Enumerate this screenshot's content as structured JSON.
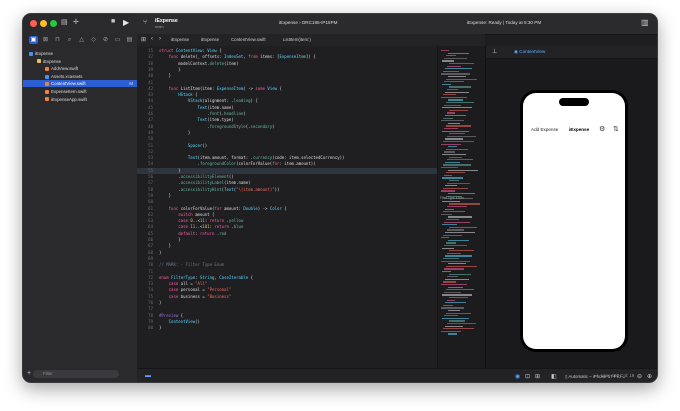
{
  "sidebar": {
    "items": [
      {
        "label": "iExpense",
        "level": 0,
        "color": "#4a90f5",
        "selected": false
      },
      {
        "label": "iExpense",
        "level": 1,
        "color": "#e8c35a",
        "selected": false
      },
      {
        "label": "AddView.swift",
        "level": 2,
        "color": "#f0813a",
        "selected": false
      },
      {
        "label": "Assets.xcassets",
        "level": 2,
        "color": "#4a90f5",
        "selected": false
      },
      {
        "label": "ContentView.swift",
        "level": 2,
        "color": "#f0813a",
        "selected": true,
        "badge": "M"
      },
      {
        "label": "ExpenseItem.swift",
        "level": 2,
        "color": "#f0813a",
        "selected": false
      },
      {
        "label": "iExpenseApp.swift",
        "level": 2,
        "color": "#f0813a",
        "selected": false
      }
    ],
    "filter_placeholder": "Filter"
  },
  "titlebar": {
    "project": "iExpense",
    "branch": "main",
    "scheme": "iExpense  ›  DRC195-IP15PM",
    "status": "iExpense: Ready | Today at 5:30 PM"
  },
  "breadcrumb": [
    "iExpense",
    "iExpense",
    "ContentView.swift",
    "ListItem(item:)"
  ],
  "code": [
    {
      "n": "15",
      "t": "struct ContentView: View {"
    },
    {
      "n": "37",
      "t": "    func delete(_ offsets: IndexSet, from items: [ExpenseItem]) {"
    },
    {
      "n": "38",
      "t": "        modelContext.delete(item)"
    },
    {
      "n": "39",
      "t": "        }"
    },
    {
      "n": "40",
      "t": "    }"
    },
    {
      "n": "41",
      "t": ""
    },
    {
      "n": "42",
      "t": "    func ListItem(item: ExpenseItem) -> some View {"
    },
    {
      "n": "43",
      "t": "        HStack {"
    },
    {
      "n": "44",
      "t": "            VStack(alignment: .leading) {"
    },
    {
      "n": "45",
      "t": "                Text(item.name)"
    },
    {
      "n": "46",
      "t": "                    .font(.headline)"
    },
    {
      "n": "47",
      "t": "                Text(item.type)"
    },
    {
      "n": "48",
      "t": "                    .foregroundStyle(.secondary)"
    },
    {
      "n": "49",
      "t": "            }"
    },
    {
      "n": "50",
      "t": ""
    },
    {
      "n": "51",
      "t": "            Spacer()"
    },
    {
      "n": "52",
      "t": ""
    },
    {
      "n": "53",
      "t": "            Text(item.amount, format: .currency(code: item.selectedCurrency))"
    },
    {
      "n": "54",
      "t": "                .foregroundColor(colorForValue(for: item.amount))"
    },
    {
      "n": "55",
      "t": "        }"
    },
    {
      "n": "56",
      "t": "        .accessibilityElement()"
    },
    {
      "n": "57",
      "t": "        .accessibilityLabel(item.name)"
    },
    {
      "n": "58",
      "t": "        .accessibilityHint(Text(\"\\(item.amount)\"))"
    },
    {
      "n": "59",
      "t": "    }"
    },
    {
      "n": "60",
      "t": ""
    },
    {
      "n": "61",
      "t": "    func colorForValue(for amount: Double) -> Color {"
    },
    {
      "n": "62",
      "t": "        switch amount {"
    },
    {
      "n": "63",
      "t": "        case 0..<11: return .yellow"
    },
    {
      "n": "64",
      "t": "        case 11..<101: return .blue"
    },
    {
      "n": "65",
      "t": "        default: return .red"
    },
    {
      "n": "66",
      "t": "        }"
    },
    {
      "n": "67",
      "t": "    }"
    },
    {
      "n": "68",
      "t": "}"
    },
    {
      "n": "69",
      "t": ""
    },
    {
      "n": "70",
      "t": "// MARK: - Filter Type Enum"
    },
    {
      "n": "71",
      "t": ""
    },
    {
      "n": "72",
      "t": "enum FilterType: String, CaseIterable {"
    },
    {
      "n": "73",
      "t": "    case all = \"All\""
    },
    {
      "n": "74",
      "t": "    case personal = \"Personal\""
    },
    {
      "n": "75",
      "t": "    case business = \"Business\""
    },
    {
      "n": "76",
      "t": "}"
    },
    {
      "n": "77",
      "t": ""
    },
    {
      "n": "78",
      "t": "#Preview {"
    },
    {
      "n": "79",
      "t": "    ContentView()"
    },
    {
      "n": "80",
      "t": "}"
    }
  ],
  "minimap": {
    "label": "Filter Type Enum"
  },
  "canvas": {
    "preview_label": "ContentView",
    "app": {
      "add_button": "Add Expense",
      "title": "iExpense"
    },
    "device": "Automatic – iPhone 17 Pro"
  },
  "status_bar": {
    "position": "Line: 107  Col: 19"
  }
}
